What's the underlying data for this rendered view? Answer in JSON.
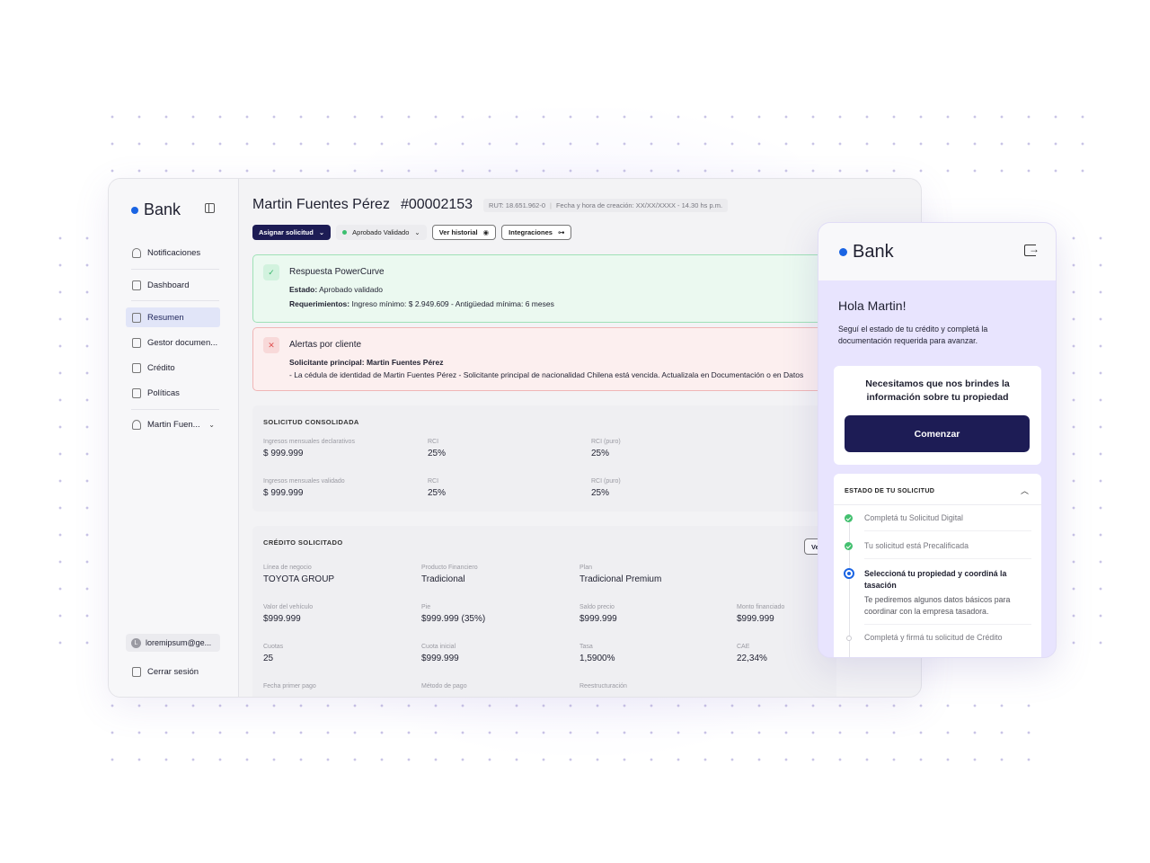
{
  "desktop": {
    "logo": "Bank",
    "sidebar": {
      "items": [
        {
          "label": "Notificaciones",
          "icon": "bell-icon"
        },
        {
          "label": "Dashboard",
          "icon": "dashboard-icon"
        },
        {
          "label": "Resumen",
          "icon": "document-icon"
        },
        {
          "label": "Gestor documen...",
          "icon": "folder-icon"
        },
        {
          "label": "Crédito",
          "icon": "credit-icon"
        },
        {
          "label": "Políticas",
          "icon": "policy-icon"
        },
        {
          "label": "Martin Fuen...",
          "icon": "user-icon"
        }
      ],
      "active": "Resumen",
      "email": "loremipsum@ge...",
      "email_avatar": "L",
      "logout": "Cerrar sesión"
    },
    "header": {
      "name": "Martin Fuentes Pérez",
      "number": "#00002153",
      "rut": "RUT: 18.651.962-0",
      "created": "Fecha y hora de creación: XX/XX/XXXX - 14.30 hs p.m."
    },
    "buttons": {
      "assign": "Asignar solicitud",
      "status": "Aprobado Validado",
      "history": "Ver historial",
      "integrations": "Integraciones"
    },
    "alert_ok": {
      "title": "Respuesta PowerCurve",
      "estado_label": "Estado:",
      "estado_value": "Aprobado validado",
      "req_label": "Requerimientos:",
      "req_value": "Ingreso mínimo: $ 2.949.609 - Antigüedad mínima: 6 meses"
    },
    "alert_err": {
      "title": "Alertas por cliente",
      "subtitle": "Solicitante principal: Martin Fuentes Pérez",
      "text": "- La cédula de identidad de Martin Fuentes Pérez  - Solicitante principal de nacionalidad Chilena está vencida. Actualizala en Documentación o en Datos"
    },
    "consolidada": {
      "title": "SOLICITUD CONSOLIDADA",
      "fields": [
        {
          "label": "Ingresos mensuales declarativos",
          "value": "$ 999.999"
        },
        {
          "label": "RCI",
          "value": "25%"
        },
        {
          "label": "RCI (puro)",
          "value": "25%"
        },
        {
          "label": "Ingresos mensuales validado",
          "value": "$ 999.999"
        },
        {
          "label": "RCI",
          "value": "25%"
        },
        {
          "label": "RCI (puro)",
          "value": "25%"
        }
      ]
    },
    "credito": {
      "title": "CRÉDITO SOLICITADO",
      "button": "Ve",
      "fields": [
        {
          "label": "Línea de negocio",
          "value": "TOYOTA GROUP"
        },
        {
          "label": "Producto Financiero",
          "value": "Tradicional"
        },
        {
          "label": "Plan",
          "value": "Tradicional Premium"
        },
        {
          "label": "Valor del vehículo",
          "value": "$999.999"
        },
        {
          "label": "Pie",
          "value": "$999.999 (35%)"
        },
        {
          "label": "Saldo precio",
          "value": "$999.999"
        },
        {
          "label": "Monto financiado",
          "value": "$999.999"
        },
        {
          "label": "Cuotas",
          "value": "25"
        },
        {
          "label": "Cuota inicial",
          "value": "$999.999"
        },
        {
          "label": "Tasa",
          "value": "1,5900%"
        },
        {
          "label": "CAE",
          "value": "22,34%"
        },
        {
          "label": "Fecha primer pago",
          "value": ""
        },
        {
          "label": "Método de pago",
          "value": ""
        },
        {
          "label": "Reestructuración",
          "value": ""
        }
      ]
    }
  },
  "mobile": {
    "logo": "Bank",
    "greeting": "Hola Martin!",
    "subtitle": "Seguí el estado de tu crédito y completá la documentación requerida para avanzar.",
    "prompt": "Necesitamos que nos brindes la información sobre tu propiedad",
    "start_button": "Comenzar",
    "status_title": "ESTADO DE TU SOLICITUD",
    "steps": [
      {
        "label": "Completá tu Solicitud Digital",
        "state": "done"
      },
      {
        "label": "Tu solicitud está Precalificada",
        "state": "done"
      },
      {
        "label": "Seleccioná tu propiedad y coordiná la tasación",
        "state": "current",
        "desc": "Te pediremos algunos datos básicos para coordinar con la empresa tasadora."
      },
      {
        "label": "Completá y firmá tu solicitud de Crédito",
        "state": "todo"
      }
    ]
  },
  "colors": {
    "brand_dot": "#1a64e3",
    "primary_button": "#1d1c55",
    "success": "#43c06f",
    "error": "#e05050",
    "mobile_background": "#e8e4fe"
  }
}
